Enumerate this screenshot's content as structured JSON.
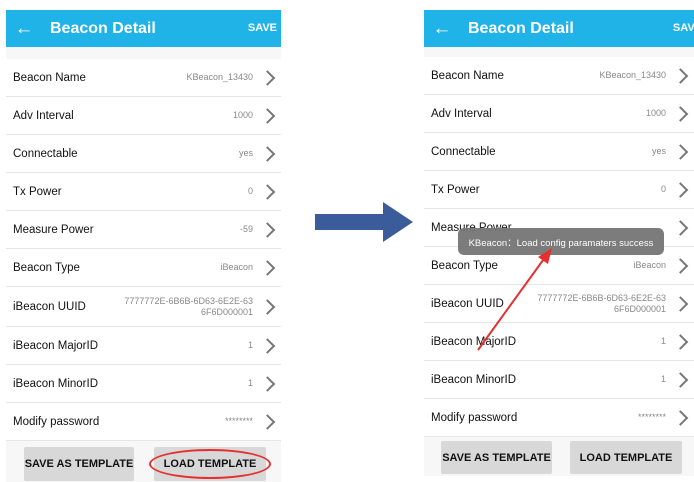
{
  "left_screen": {
    "appbar": {
      "back_glyph": "←",
      "title": "Beacon Detail",
      "save_label": "SAVE"
    },
    "rows": [
      {
        "label": "Beacon Name",
        "value": "KBeacon_13430"
      },
      {
        "label": "Adv Interval",
        "value": "1000"
      },
      {
        "label": "Connectable",
        "value": "yes"
      },
      {
        "label": "Tx Power",
        "value": "0"
      },
      {
        "label": "Measure Power",
        "value": "-59"
      },
      {
        "label": "Beacon Type",
        "value": "iBeacon"
      },
      {
        "label": "iBeacon UUID",
        "value": "7777772E-6B6B-6D63-6E2E-63 6F6D000001"
      },
      {
        "label": "iBeacon MajorID",
        "value": "1"
      },
      {
        "label": "iBeacon MinorID",
        "value": "1"
      },
      {
        "label": "Modify password",
        "value": "********"
      }
    ],
    "buttons": {
      "save_template": "SAVE AS TEMPLATE",
      "load_template": "LOAD TEMPLATE"
    }
  },
  "right_screen": {
    "appbar": {
      "back_glyph": "←",
      "title": "Beacon Detail",
      "save_label": "SAVE"
    },
    "rows": [
      {
        "label": "Beacon Name",
        "value": "KBeacon_13430"
      },
      {
        "label": "Adv Interval",
        "value": "1000"
      },
      {
        "label": "Connectable",
        "value": "yes"
      },
      {
        "label": "Tx Power",
        "value": "0"
      },
      {
        "label": "Measure Power",
        "value": ""
      },
      {
        "label": "Beacon Type",
        "value": "iBeacon"
      },
      {
        "label": "iBeacon UUID",
        "value": "7777772E-6B6B-6D63-6E2E-63 6F6D000001"
      },
      {
        "label": "iBeacon MajorID",
        "value": "1"
      },
      {
        "label": "iBeacon MinorID",
        "value": "1"
      },
      {
        "label": "Modify password",
        "value": "********"
      }
    ],
    "buttons": {
      "save_template": "SAVE AS TEMPLATE",
      "load_template": "LOAD TEMPLATE"
    },
    "toast": "KBeacon：Load config paramaters success"
  },
  "colors": {
    "appbar": "#1fb3e8",
    "flow_arrow": "#3b5c9a",
    "highlight": "#e53030"
  }
}
